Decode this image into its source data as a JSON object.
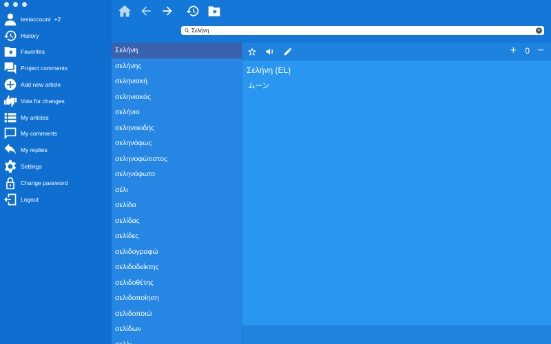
{
  "sidebar": {
    "user": {
      "name": "testaccount",
      "extra": "+2"
    },
    "items": [
      {
        "label": "History",
        "icon": "history-icon"
      },
      {
        "label": "Favorites",
        "icon": "favorites-icon"
      },
      {
        "label": "Project comments",
        "icon": "project-comments-icon"
      },
      {
        "label": "Add new article",
        "icon": "add-article-icon"
      },
      {
        "label": "Vote for changes",
        "icon": "vote-icon"
      },
      {
        "label": "My articles",
        "icon": "list-icon"
      },
      {
        "label": "My comments",
        "icon": "comment-icon"
      },
      {
        "label": "My replies",
        "icon": "reply-icon"
      },
      {
        "label": "Settings",
        "icon": "gear-icon"
      },
      {
        "label": "Change password",
        "icon": "lock-icon"
      },
      {
        "label": "Logout",
        "icon": "logout-icon"
      }
    ]
  },
  "search": {
    "value": "Σελήνη"
  },
  "words": [
    "Σελήνη",
    "σελήνης",
    "σεληνιακή",
    "σεληνιακός",
    "σελήνιο",
    "σεληνοειδής",
    "σεληνόφως",
    "σεληνοφώτιστος",
    "σεληνόφωτο",
    "σέλι",
    "σελίδα",
    "σελίδας",
    "σελίδες",
    "σελιδογραφώ",
    "σελιδοδείκτης",
    "σελιδοθέτης",
    "σελιδοποίηση",
    "σελιδοποιώ",
    "σελίδων",
    "σελίν"
  ],
  "article": {
    "title": "Σελήνη (EL)",
    "body": "ムーン",
    "vote_count": "0"
  },
  "colors": {
    "sidebar": "#0f6fd0",
    "topbar": "#1478da",
    "list": "#2586e3",
    "selected": "#3a62ad",
    "content": "#2996ef"
  }
}
